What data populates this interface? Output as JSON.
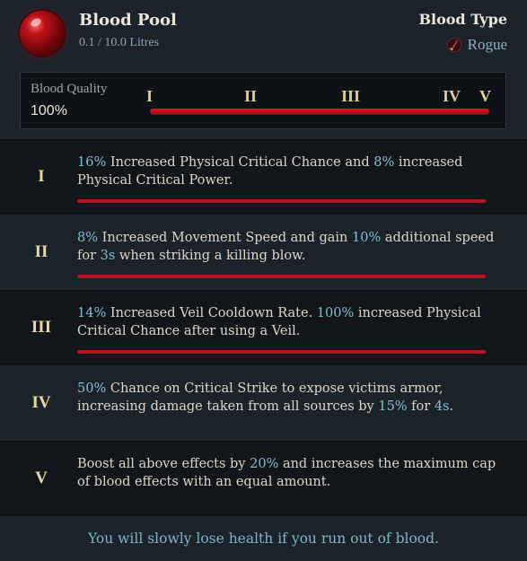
{
  "pool": {
    "title": "Blood Pool",
    "amount": "0.1 / 10.0  Litres"
  },
  "blood_type": {
    "label": "Blood Type",
    "value": "Rogue",
    "icon": "rogue-icon"
  },
  "quality": {
    "label": "Blood Quality",
    "value": "100%",
    "tiers": [
      "I",
      "II",
      "III",
      "IV",
      "V"
    ],
    "fill_fraction": 1.0
  },
  "tiers": [
    {
      "numeral": "I",
      "parts": [
        {
          "t": "16%",
          "hl": true
        },
        {
          "t": " Increased Physical Critical Chance and ",
          "hl": false
        },
        {
          "t": "8%",
          "hl": true
        },
        {
          "t": " increased Physical Critical Power.",
          "hl": false
        }
      ],
      "bar": true
    },
    {
      "numeral": "II",
      "parts": [
        {
          "t": "8%",
          "hl": true
        },
        {
          "t": " Increased Movement Speed and gain ",
          "hl": false
        },
        {
          "t": "10%",
          "hl": true
        },
        {
          "t": " additional speed for ",
          "hl": false
        },
        {
          "t": "3s",
          "hl": true
        },
        {
          "t": " when striking a killing blow.",
          "hl": false
        }
      ],
      "bar": true
    },
    {
      "numeral": "III",
      "parts": [
        {
          "t": "14%",
          "hl": true
        },
        {
          "t": " Increased Veil Cooldown Rate. ",
          "hl": false
        },
        {
          "t": "100%",
          "hl": true
        },
        {
          "t": " increased Physical Critical Chance after using a Veil.",
          "hl": false
        }
      ],
      "bar": true
    },
    {
      "numeral": "IV",
      "parts": [
        {
          "t": "50%",
          "hl": true
        },
        {
          "t": " Chance on Critical Strike to expose victims armor, increasing damage taken from all sources by ",
          "hl": false
        },
        {
          "t": "15%",
          "hl": true
        },
        {
          "t": " for ",
          "hl": false
        },
        {
          "t": "4s",
          "hl": true
        },
        {
          "t": ".",
          "hl": false
        }
      ],
      "bar": false
    },
    {
      "numeral": "V",
      "parts": [
        {
          "t": "Boost all above effects by ",
          "hl": false
        },
        {
          "t": "20%",
          "hl": true
        },
        {
          "t": " and increases the maximum cap of blood effects with an equal amount.",
          "hl": false
        }
      ],
      "bar": false
    }
  ],
  "footer": "You will slowly lose health if you run out of blood.",
  "colors": {
    "highlight": "#7fc0d0",
    "bar_red": "#b81420",
    "numeral_gold": "#e6d9ac"
  }
}
